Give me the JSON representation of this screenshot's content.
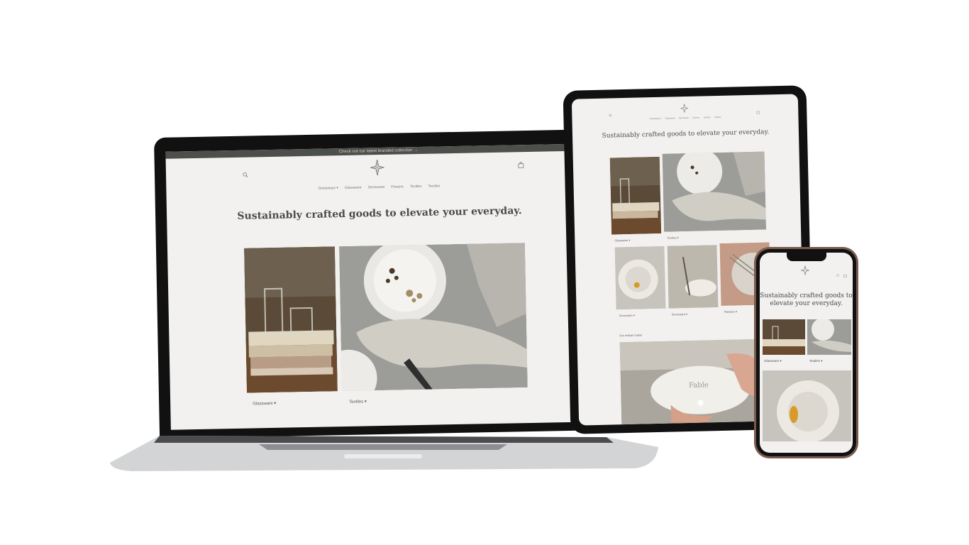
{
  "store": {
    "announcement": "Check out our latest branded collection →",
    "nav": [
      "Giveaways",
      "Glassware",
      "Serveware",
      "Flowers",
      "Textiles",
      "Textiles"
    ],
    "hero_title": "Sustainably crafted goods to elevate your everyday.",
    "tiles": [
      "Glassware",
      "Textiles",
      "Serveware",
      "Serveware",
      "Flatware"
    ],
    "section_label": "Our artisan maker",
    "plate_text": "Fable",
    "caret": "▾"
  },
  "colors": {
    "page_bg": "#f2f1ef",
    "announcement_bg": "#4d4f4b",
    "text": "#4b4b48"
  },
  "icons": {
    "search": "search-icon",
    "logo": "leaf-star-logo",
    "cart": "bag-icon"
  }
}
